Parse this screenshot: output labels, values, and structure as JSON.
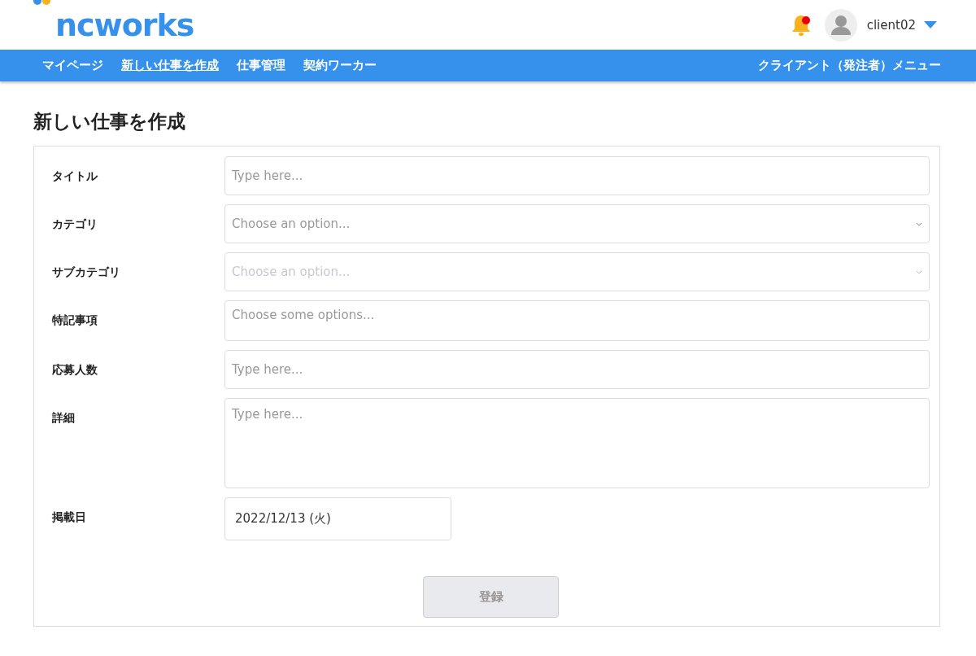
{
  "header": {
    "logo": "ncworks",
    "notification": {
      "unread": true
    },
    "user": {
      "name": "client02"
    }
  },
  "nav": {
    "items": [
      {
        "label": "マイページ",
        "selected": false
      },
      {
        "label": "新しい仕事を作成",
        "selected": true
      },
      {
        "label": "仕事管理",
        "selected": false
      },
      {
        "label": "契約ワーカー",
        "selected": false
      }
    ],
    "menu_label": "クライアント（発注者）メニュー"
  },
  "page_title": "新しい仕事を作成",
  "form": {
    "fields": [
      {
        "label": "タイトル",
        "kind": "text",
        "placeholder": "Type here...",
        "disabled": false
      },
      {
        "label": "カテゴリ",
        "kind": "select",
        "placeholder": "Choose an option...",
        "disabled": false
      },
      {
        "label": "サブカテゴリ",
        "kind": "select",
        "placeholder": "Choose an option...",
        "disabled": true
      },
      {
        "label": "特記事項",
        "kind": "multiselect",
        "placeholder": "Choose some options...",
        "disabled": false
      },
      {
        "label": "応募人数",
        "kind": "text",
        "placeholder": "Type here...",
        "disabled": false
      },
      {
        "label": "詳細",
        "kind": "textarea",
        "placeholder": "Type here...",
        "disabled": false
      },
      {
        "label": "掲載日",
        "kind": "date",
        "value": "2022/12/13 (火)",
        "disabled": false
      }
    ],
    "submit": {
      "label": "登録",
      "disabled": true
    }
  }
}
